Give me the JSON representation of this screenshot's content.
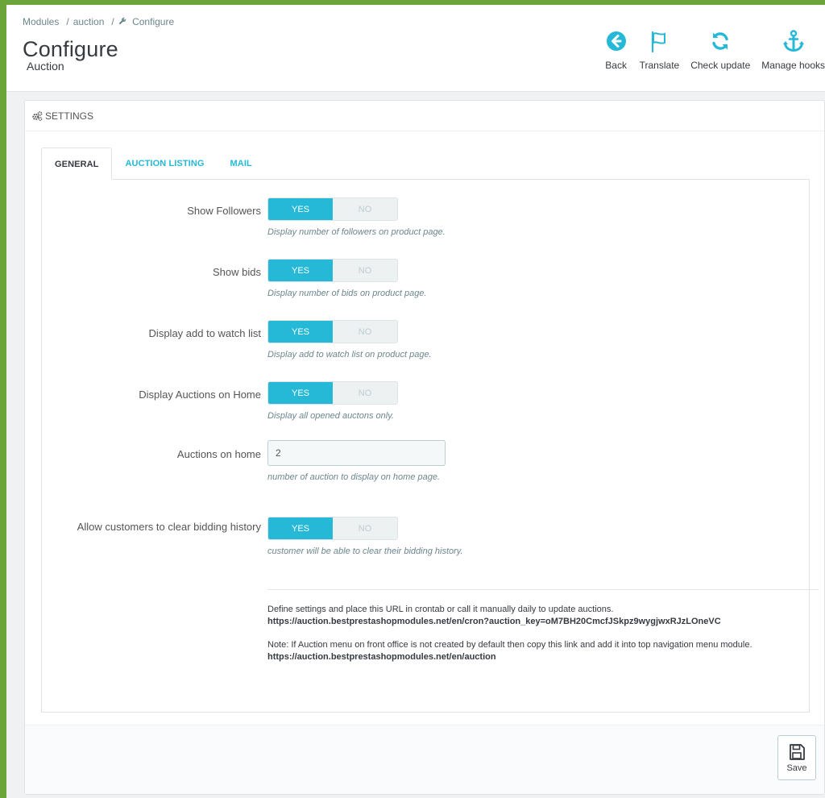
{
  "breadcrumb": [
    "Modules",
    "auction",
    "Configure"
  ],
  "breadcrumb_separator": "/",
  "page": {
    "title": "Configure",
    "subtitle": "Auction"
  },
  "toolbar": {
    "back": "Back",
    "translate": "Translate",
    "check_update": "Check update",
    "manage_hooks": "Manage hooks"
  },
  "panel": {
    "heading": "SETTINGS"
  },
  "tabs": [
    {
      "label": "GENERAL",
      "active": true
    },
    {
      "label": "AUCTION LISTING",
      "active": false
    },
    {
      "label": "MAIL",
      "active": false
    }
  ],
  "switch_labels": {
    "yes": "YES",
    "no": "NO"
  },
  "fields": {
    "show_followers": {
      "label": "Show Followers",
      "value": "YES",
      "help": "Display number of followers on product page."
    },
    "show_bids": {
      "label": "Show bids",
      "value": "YES",
      "help": "Display number of bids on product page."
    },
    "watch_list": {
      "label": "Display add to watch list",
      "value": "YES",
      "help": "Display add to watch list on product page."
    },
    "auctions_home": {
      "label": "Display Auctions on Home",
      "value": "YES",
      "help": "Display all opened auctons only."
    },
    "auctions_on_home": {
      "label": "Auctions on home",
      "value": "2",
      "help": "number of auction to display on home page."
    },
    "clear_history": {
      "label": "Allow customers to clear bidding history",
      "value": "YES",
      "help": "customer will be able to clear their bidding history."
    }
  },
  "info": {
    "cron_text": "Define settings and place this URL in crontab or call it manually daily to update auctions.",
    "cron_url": "https://auction.bestprestashopmodules.net/en/cron?auction_key=oM7BH20CmcfJSkpz9wygjwxRJzLOneVC",
    "note_text": "Note: If Auction menu on front office is not created by default then copy this link and add it into top navigation menu module.",
    "note_url": "https://auction.bestprestashopmodules.net/en/auction"
  },
  "footer": {
    "save": "Save"
  },
  "colors": {
    "accent": "#25b9d7",
    "frame": "#6ba53a",
    "text_dark": "#363a41"
  },
  "icons": {
    "back": "back-circle-icon",
    "translate": "flag-icon",
    "check_update": "refresh-icon",
    "manage_hooks": "anchor-icon",
    "settings": "cogs-icon",
    "configure": "wrench-icon",
    "save": "floppy-disk-icon"
  }
}
